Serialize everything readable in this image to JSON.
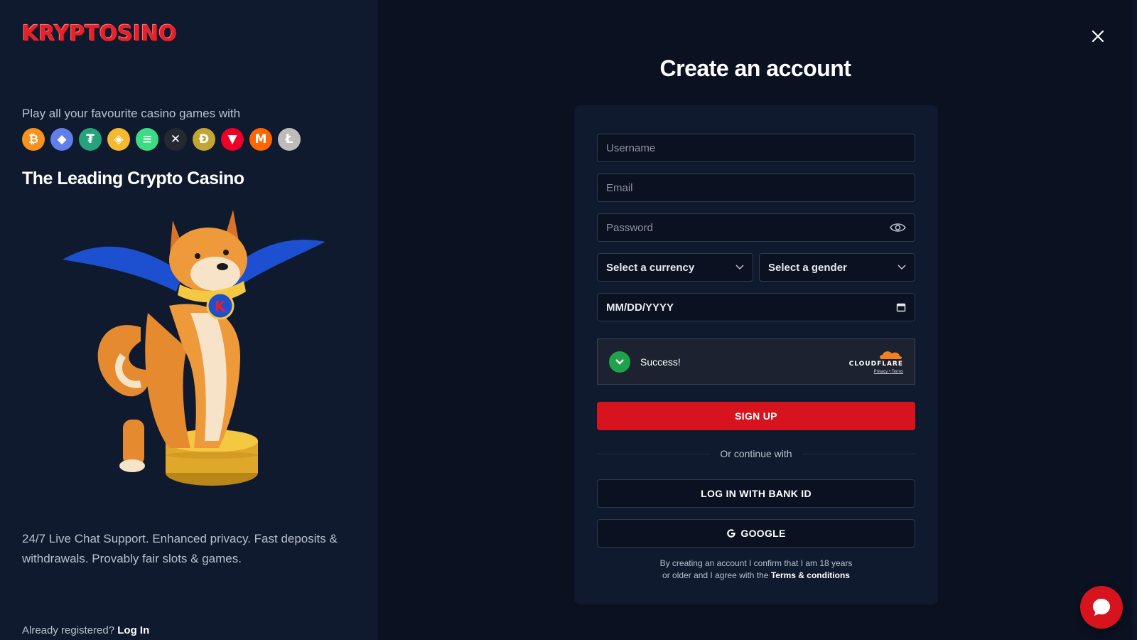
{
  "brand": {
    "logo_text": "KRYPTOSINO",
    "accent": "#d7141e"
  },
  "left": {
    "tagline": "Play all your favourite casino games with",
    "coins": [
      {
        "name": "bitcoin-icon",
        "glyph": "₿",
        "color": "#f7931a"
      },
      {
        "name": "ethereum-icon",
        "glyph": "◆",
        "color": "#627eea"
      },
      {
        "name": "tether-icon",
        "glyph": "₮",
        "color": "#26a17b"
      },
      {
        "name": "bnb-icon",
        "glyph": "◈",
        "color": "#f3ba2f"
      },
      {
        "name": "solana-icon",
        "glyph": "≡",
        "color": "#3ddc84"
      },
      {
        "name": "xrp-icon",
        "glyph": "✕",
        "color": "#23292f"
      },
      {
        "name": "dogecoin-icon",
        "glyph": "Ð",
        "color": "#c2a633"
      },
      {
        "name": "tron-icon",
        "glyph": "▼",
        "color": "#ef0027"
      },
      {
        "name": "monero-icon",
        "glyph": "M",
        "color": "#ff6600"
      },
      {
        "name": "litecoin-icon",
        "glyph": "Ł",
        "color": "#bfbbbb"
      }
    ],
    "headline": "The Leading Crypto Casino",
    "features": "24/7 Live Chat Support. Enhanced privacy. Fast deposits & withdrawals. Provably fair slots & games.",
    "already_text": "Already registered?",
    "login_link": "Log In"
  },
  "form": {
    "title": "Create an account",
    "username_placeholder": "Username",
    "email_placeholder": "Email",
    "password_placeholder": "Password",
    "currency_label": "Select a currency",
    "gender_label": "Select a gender",
    "dob_placeholder": "MM/DD/YYYY",
    "captcha_status": "Success!",
    "captcha_brand": "CLOUDFLARE",
    "captcha_privacy": "Privacy",
    "captcha_sep": "•",
    "captcha_terms": "Terms",
    "signup_label": "SIGN UP",
    "divider_text": "Or continue with",
    "bankid_label": "LOG IN WITH BANK ID",
    "google_label": "GOOGLE",
    "terms_line1": "By creating an account I confirm that I am 18 years",
    "terms_line2": "or older and I agree with the",
    "terms_link": "Terms & conditions"
  }
}
